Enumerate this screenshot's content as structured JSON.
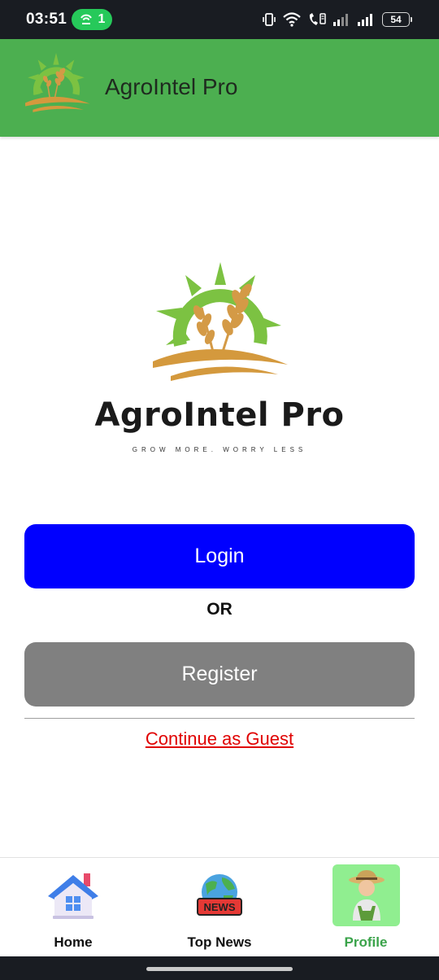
{
  "status_bar": {
    "time": "03:51",
    "hotspot_count": "1",
    "battery_level": "54",
    "icons": [
      "hotspot-icon",
      "vibrate-icon",
      "wifi-icon",
      "wifi-calling-icon",
      "signal-icon",
      "signal-icon",
      "battery-icon"
    ]
  },
  "app_bar": {
    "title": "AgroIntel Pro",
    "background": "#4caf50"
  },
  "brand": {
    "name": "AgroIntel Pro",
    "tagline": "GROW MORE. WORRY LESS",
    "logo_colors": {
      "sun": "#7cc242",
      "wheat": "#d49a46",
      "ground": "#d4993d"
    }
  },
  "actions": {
    "login_label": "Login",
    "login_color": "#0000ff",
    "or_label": "OR",
    "register_label": "Register",
    "register_color": "#808080",
    "guest_label": "Continue as Guest",
    "guest_color": "#e00000"
  },
  "bottom_nav": {
    "items": [
      {
        "label": "Home",
        "icon": "house-icon",
        "active": false
      },
      {
        "label": "Top News",
        "icon": "news-globe-icon",
        "badge": "NEWS",
        "active": false
      },
      {
        "label": "Profile",
        "icon": "farmer-avatar-icon",
        "active": true
      }
    ],
    "active_color": "#3aa34a",
    "active_bg": "#90ee90"
  }
}
